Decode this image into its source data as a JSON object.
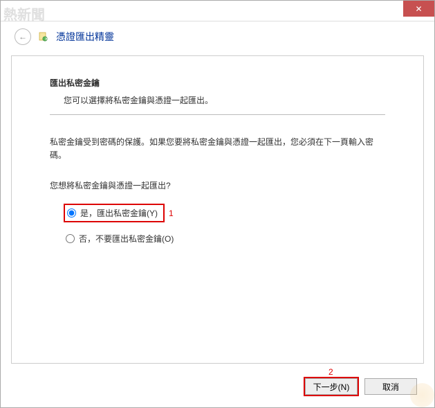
{
  "watermark_text": "熱新聞",
  "titlebar": {
    "close_label": "✕"
  },
  "header": {
    "back_arrow": "←",
    "title": "憑證匯出精靈"
  },
  "content": {
    "section_title": "匯出私密金鑰",
    "section_desc": "您可以選擇將私密金鑰與憑證一起匯出。",
    "info_text": "私密金鑰受到密碼的保護。如果您要將私密金鑰與憑證一起匯出，您必須在下一頁輸入密碼。",
    "question_text": "您想將私密金鑰與憑證一起匯出?",
    "radio_options": {
      "yes": "是，匯出私密金鑰(Y)",
      "no": "否，不要匯出私密金鑰(O)"
    },
    "annotation_1": "1",
    "annotation_2": "2"
  },
  "buttons": {
    "next": "下一步(N)",
    "cancel": "取消"
  }
}
